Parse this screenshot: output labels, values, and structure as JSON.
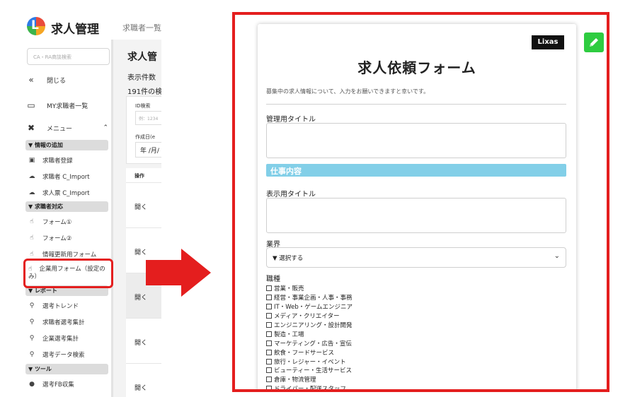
{
  "app": {
    "title": "求人管理",
    "header_link": "求職者一覧",
    "search_placeholder": "CA・RA商談検索",
    "nav": {
      "close": "閉じる",
      "my_seekers": "MY求職者一覧",
      "menu": "メニュー"
    },
    "sections": [
      {
        "label": "▼ 情報の追加",
        "items": [
          "求職者登録",
          "求職者 C_Import",
          "求人票 C_Import"
        ]
      },
      {
        "label": "▼ 求職者対応",
        "items": [
          "フォーム①",
          "フォーム②",
          "情報更新用フォーム"
        ]
      },
      {
        "label": "▼ レポート",
        "items": [
          "選考トレンド",
          "求職者選考集計",
          "企業選考集計",
          "選考データ検索"
        ]
      },
      {
        "label": "▼ ツール",
        "items": [
          "選考FB収集"
        ]
      }
    ],
    "highlighted_item": "企業用フォーム（設定のみ）",
    "main": {
      "title": "求人管",
      "count_label": "表示件数",
      "count": "191件の検",
      "filter_id_label": "ID検索",
      "filter_id_placeholder": "例：1234",
      "filter_date_label": "作成日(e",
      "filter_date_value": "年 /月/",
      "table_header": "操作",
      "open_label": "開く"
    }
  },
  "form": {
    "logo": "Lixas",
    "title": "求人依頼フォーム",
    "intro": "募集中の求人情報について、入力をお願いできますと幸いです。",
    "mgmt_title_label": "管理用タイトル",
    "section_heading": "仕事内容",
    "display_title_label": "表示用タイトル",
    "industry_label": "業界",
    "industry_select_value": "▼ 選択する",
    "job_type_label": "職種",
    "job_types": [
      "営業・販売",
      "経営・事業企画・人事・事務",
      "IT・Web・ゲームエンジニア",
      "メディア・クリエイター",
      "エンジニアリング・設計開発",
      "製造・工場",
      "マーケティング・広告・宣伝",
      "飲食・フードサービス",
      "旅行・レジャー・イベント",
      "ビューティー・生活サービス",
      "倉庫・物流管理",
      "ドライバー・配送スタッフ"
    ]
  },
  "colors": {
    "highlight": "#e41e1e",
    "section_bar": "#82cfe8",
    "edit_button": "#2ecc40"
  },
  "icons": {
    "edit": "pencil-icon",
    "arrow": "right-arrow-icon"
  }
}
